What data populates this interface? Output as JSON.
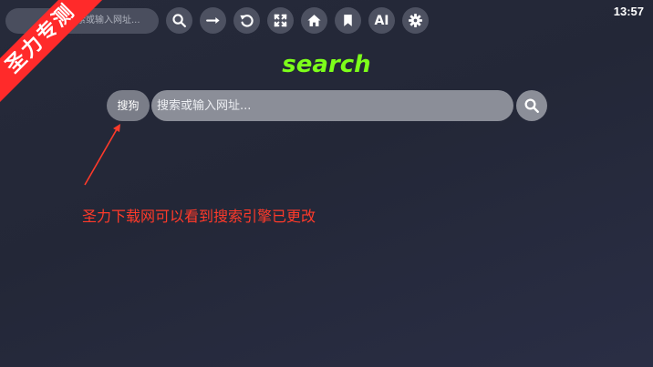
{
  "top_search": {
    "placeholder": "索或输入网址..."
  },
  "toolbar": {
    "icons": [
      "search-icon",
      "arrow-right-icon",
      "refresh-icon",
      "fullscreen-icon",
      "home-icon",
      "bookmark-icon",
      "ai-label",
      "gear-icon"
    ],
    "ai_label": "AI"
  },
  "status": {
    "time": "13:57"
  },
  "ribbon": {
    "text": "圣力专测",
    "color": "#ff2a2a"
  },
  "logo": {
    "text": "search",
    "color": "#7dff1a"
  },
  "search_bar": {
    "engine_label": "搜狗",
    "placeholder": "搜索或输入网址..."
  },
  "annotation": {
    "text": "圣力下载网可以看到搜索引擎已更改",
    "color": "#ff3a2a"
  }
}
